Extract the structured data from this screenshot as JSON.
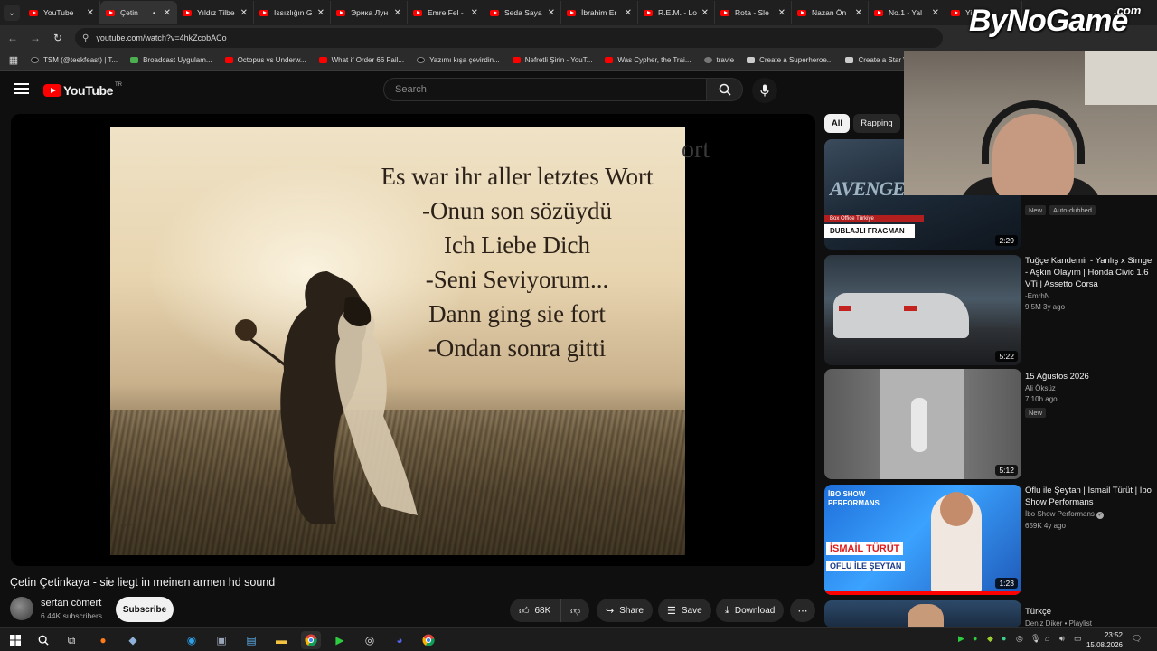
{
  "browser": {
    "tabs": [
      {
        "title": "YouTube",
        "active": false
      },
      {
        "title": "Çetin",
        "active": true
      },
      {
        "title": "Yıldız Tilbe",
        "active": false
      },
      {
        "title": "Issızlığın G",
        "active": false
      },
      {
        "title": "Эрика Лун",
        "active": false
      },
      {
        "title": "Emre Fel -",
        "active": false
      },
      {
        "title": "Seda Saya",
        "active": false
      },
      {
        "title": "İbrahim Er",
        "active": false
      },
      {
        "title": "R.E.M. - Lo",
        "active": false
      },
      {
        "title": "Rota - Sle",
        "active": false
      },
      {
        "title": "Nazan Ön",
        "active": false
      },
      {
        "title": "No.1 - Yal",
        "active": false
      },
      {
        "title": "Yi",
        "active": false
      }
    ],
    "url": "youtube.com/watch?v=4hkZcobACo",
    "bookmarks": [
      {
        "label": "TSM (@teekfeast) | T...",
        "icon": "tiktok"
      },
      {
        "label": "Broadcast Uygulam...",
        "icon": "green"
      },
      {
        "label": "Octopus vs Underw...",
        "icon": "youtube"
      },
      {
        "label": "What if Order 66 Fail...",
        "icon": "youtube"
      },
      {
        "label": "Yazımı kışa çevirdin...",
        "icon": "tiktok"
      },
      {
        "label": "Nefretli Şirin - YouT...",
        "icon": "youtube"
      },
      {
        "label": "Was Cypher, the Trai...",
        "icon": "youtube"
      },
      {
        "label": "travle",
        "icon": "globe"
      },
      {
        "label": "Create a Superheroe...",
        "icon": "doc"
      },
      {
        "label": "Create a Star Wars C...",
        "icon": "doc"
      }
    ]
  },
  "yt": {
    "logo_text": "YouTube",
    "logo_country": "TR",
    "search_placeholder": "Search"
  },
  "video": {
    "lyrics": [
      "Es war ihr aller letztes Wort",
      "-Onun son sözüydü",
      "Ich Liebe Dich",
      "-Seni Seviyorum...",
      "Dann ging sie fort",
      "-Ondan sonra gitti"
    ],
    "ghost_text": "ort",
    "title": "Çetin Çetinkaya - sie liegt in meinen armen hd sound",
    "channel": "sertan cömert",
    "subscribers": "6.44K subscribers",
    "subscribe_label": "Subscribe",
    "likes": "68K",
    "share_label": "Share",
    "save_label": "Save",
    "download_label": "Download"
  },
  "chips": [
    "All",
    "Rapping"
  ],
  "recommendations": [
    {
      "title": "",
      "channel": "",
      "stats": "",
      "badges": [
        "New",
        "Auto-dubbed"
      ],
      "duration": "2:29",
      "thumb_text": "DUBLAJLI FRAGMAN",
      "thumb_sub": "Box Office Türkiye",
      "thumb_logo": "AVENGERS"
    },
    {
      "title": "Tuğçe Kandemir - Yanlış x Simge - Aşkın Olayım | Honda Civic 1.6 VTi | Assetto Corsa",
      "channel": "-EmrhN",
      "stats": "9.5M  3y ago",
      "badges": [],
      "duration": "5:22"
    },
    {
      "title": "15 Ağustos 2026",
      "channel": "Ali Öksüz",
      "stats": "7  10h ago",
      "badges": [
        "New"
      ],
      "duration": "5:12"
    },
    {
      "title": "Oflu ile Şeytan | İsmail Türüt | İbo Show Performans",
      "channel": "İbo Show Performans",
      "stats": "659K  4y ago",
      "badges": [],
      "duration": "1:23",
      "thumb_text": "İSMAİL TÜRÜT",
      "thumb_sub": "OFLU İLE ŞEYTAN",
      "thumb_top": "İBO SHOW PERFORMANS"
    },
    {
      "title": "Türkçe",
      "channel": "Deniz Diker • Playlist",
      "stats": "",
      "badges": [],
      "duration": ""
    }
  ],
  "watermark": {
    "text": "ByNoGame",
    "suffix": ".com"
  },
  "taskbar": {
    "time": "23:52",
    "date": "15.08.2026"
  }
}
